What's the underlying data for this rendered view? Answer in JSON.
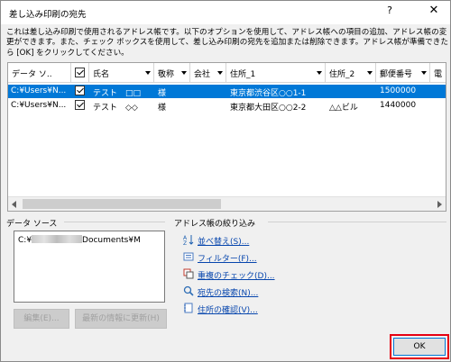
{
  "window": {
    "title": "差し込み印刷の宛先",
    "help": "?",
    "close": "✕"
  },
  "description": "これは差し込み印刷で使用されるアドレス帳です。以下のオプションを使用して、アドレス帳への項目の追加、アドレス帳の変更ができます。また、チェック ボックスを使用して、差し込み印刷の宛先を追加または削除できます。アドレス帳が準備できたら [OK] をクリックしてください。",
  "grid": {
    "headers": [
      "データ ソ..",
      "",
      "氏名",
      "敬称",
      "会社",
      "住所_1",
      "住所_2",
      "郵便番号",
      "電"
    ],
    "rows": [
      {
        "source": "C:¥Users¥N...",
        "checked": true,
        "name": "テスト　□□",
        "honorific": "様",
        "company": "",
        "address1": "東京都渋谷区○○1-1",
        "address2": "",
        "postal": "1500000",
        "selected": true
      },
      {
        "source": "C:¥Users¥N...",
        "checked": true,
        "name": "テスト　◇◇",
        "honorific": "様",
        "company": "",
        "address1": "東京都大田区○○2-2",
        "address2": "△△ビル",
        "postal": "1440000",
        "selected": false
      }
    ]
  },
  "datasource": {
    "label": "データ ソース",
    "item_prefix": "C:¥",
    "item_suffix": "Documents¥M",
    "edit_button": "編集(E)...",
    "refresh_button": "最新の情報に更新(H)"
  },
  "refine": {
    "label": "アドレス帳の絞り込み",
    "links": [
      "並べ替え(S)...",
      "フィルター(F)...",
      "重複のチェック(D)...",
      "宛先の検索(N)...",
      "住所の確認(V)..."
    ]
  },
  "ok_button": "OK"
}
